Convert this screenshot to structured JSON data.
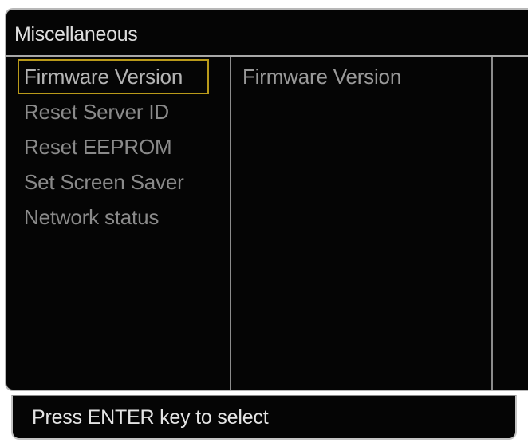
{
  "panel": {
    "title": "Miscellaneous"
  },
  "menu": {
    "items": [
      {
        "label": "Firmware Version",
        "selected": true
      },
      {
        "label": "Reset Server ID",
        "selected": false
      },
      {
        "label": "Reset EEPROM",
        "selected": false
      },
      {
        "label": "Set Screen Saver",
        "selected": false
      },
      {
        "label": "Network status",
        "selected": false
      }
    ]
  },
  "detail": {
    "text": "Firmware Version"
  },
  "footer": {
    "hint": "Press ENTER key to select"
  },
  "colors": {
    "background": "#050505",
    "selection_border": "#b99a1a",
    "menu_text": "#8a8a8a",
    "title_text": "#dedede"
  }
}
